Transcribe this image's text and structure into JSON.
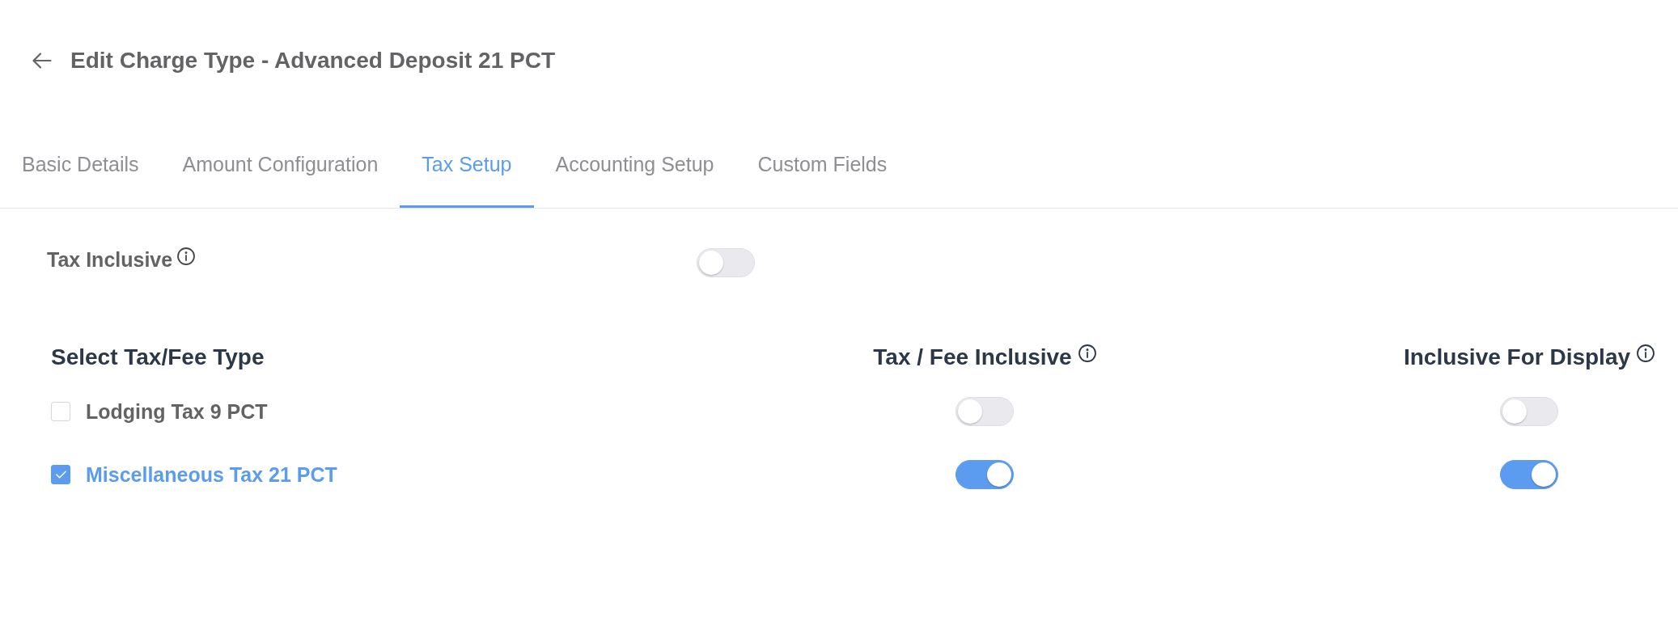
{
  "header": {
    "title": "Edit Charge Type - Advanced Deposit 21 PCT"
  },
  "tabs": [
    {
      "label": "Basic Details",
      "selected": false
    },
    {
      "label": "Amount Configuration",
      "selected": false
    },
    {
      "label": "Tax Setup",
      "selected": true
    },
    {
      "label": "Accounting Setup",
      "selected": false
    },
    {
      "label": "Custom Fields",
      "selected": false
    }
  ],
  "tax_inclusive": {
    "label": "Tax Inclusive",
    "on": false
  },
  "tax_table": {
    "columns": [
      "Select Tax/Fee Type",
      "Tax / Fee Inclusive",
      "Inclusive For Display"
    ],
    "rows": [
      {
        "name": "Lodging Tax 9 PCT",
        "checked": false,
        "fee_inclusive": false,
        "inclusive_for_display": false
      },
      {
        "name": "Miscellaneous Tax 21 PCT",
        "checked": true,
        "fee_inclusive": true,
        "inclusive_for_display": true
      }
    ]
  }
}
